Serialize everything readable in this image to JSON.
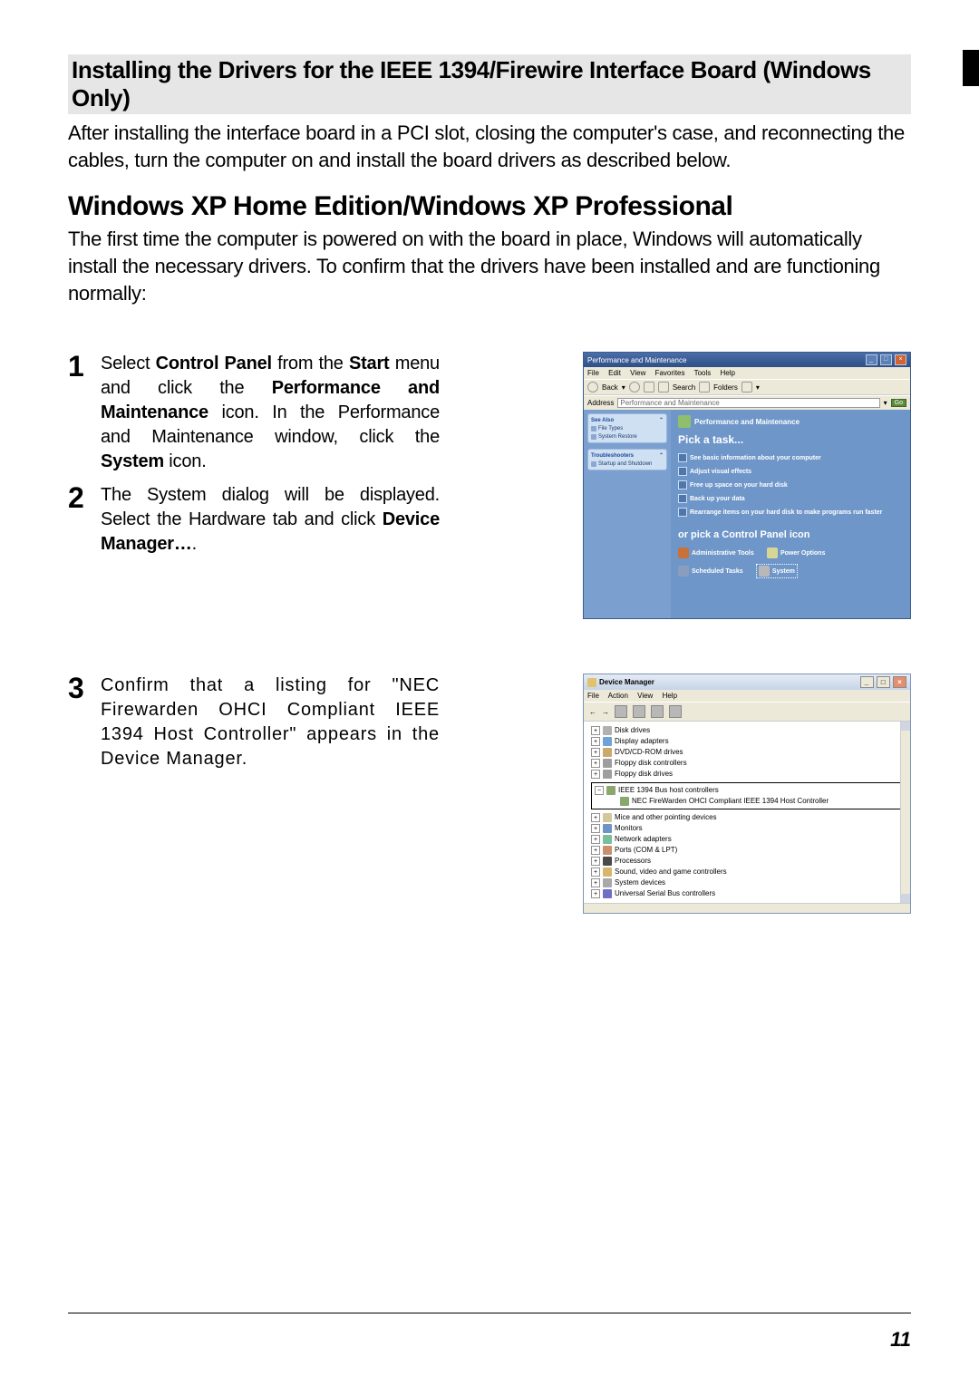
{
  "section_title": "Installing the Drivers for the IEEE 1394/Firewire Interface Board (Windows Only)",
  "intro": "After installing the interface board in a PCI slot, closing the computer's case, and reconnecting the cables, turn the computer on and install the board drivers as described below.",
  "subheading": "Windows XP Home Edition/Windows XP Professional",
  "sub_para": "The first time the computer is powered on with the board in place, Windows will automatically install the necessary drivers.  To confirm that the drivers have been installed and are functioning normally:",
  "steps": {
    "s1": {
      "num": "1",
      "pre": "Select ",
      "b1": "Control Panel",
      "mid1": " from the ",
      "b2": "Start",
      "mid2": " menu and click the ",
      "b3": "Performance and Maintenance",
      "mid3": " icon.  In the Perfor­mance and Maintenance window, click the ",
      "b4": "System",
      "post": " icon."
    },
    "s2": {
      "num": "2",
      "pre": "The System dialog will be displayed.  Select the Hardware tab and click ",
      "b1": "Device Manager…",
      "post": "."
    },
    "s3": {
      "num": "3",
      "text": "Confirm that a listing for \"NEC Firewarden OHCI Compliant IEEE 1394 Host Controller\" appears in the De­vice Manager."
    }
  },
  "shot1": {
    "title": "Performance and Maintenance",
    "menu": {
      "file": "File",
      "edit": "Edit",
      "view": "View",
      "fav": "Favorites",
      "tools": "Tools",
      "help": "Help"
    },
    "toolbar": {
      "back": "Back",
      "search": "Search",
      "folders": "Folders"
    },
    "address_label": "Address",
    "address_value": "Performance and Maintenance",
    "go": "Go",
    "side": {
      "box1_title": "See Also",
      "box1_items": [
        "File Types",
        "System Restore"
      ],
      "box2_title": "Troubleshooters",
      "box2_items": [
        "Startup and Shutdown"
      ]
    },
    "category": "Performance and Maintenance",
    "pick_task": "Pick a task...",
    "tasks": [
      "See basic information about your computer",
      "Adjust visual effects",
      "Free up space on your hard disk",
      "Back up your data",
      "Rearrange items on your hard disk to make programs run faster"
    ],
    "pick_icon": "or pick a Control Panel icon",
    "icons": {
      "admin": "Administrative Tools",
      "power": "Power Options",
      "sched": "Scheduled Tasks",
      "system": "System"
    }
  },
  "shot2": {
    "title": "Device Manager",
    "menu": {
      "file": "File",
      "action": "Action",
      "view": "View",
      "help": "Help"
    },
    "nodes": {
      "disk": "Disk drives",
      "display": "Display adapters",
      "dvd": "DVD/CD-ROM drives",
      "floppyc": "Floppy disk controllers",
      "floppyd": "Floppy disk drives",
      "ieee": "IEEE 1394 Bus host controllers",
      "ieee_child": "NEC FireWarden OHCI Compliant IEEE 1394 Host Controller",
      "mice": "Mice and other pointing devices",
      "monitors": "Monitors",
      "network": "Network adapters",
      "ports": "Ports (COM & LPT)",
      "processors": "Processors",
      "sound": "Sound, video and game controllers",
      "sysdev": "System devices",
      "usb": "Universal Serial Bus controllers"
    }
  },
  "page_number": "11"
}
